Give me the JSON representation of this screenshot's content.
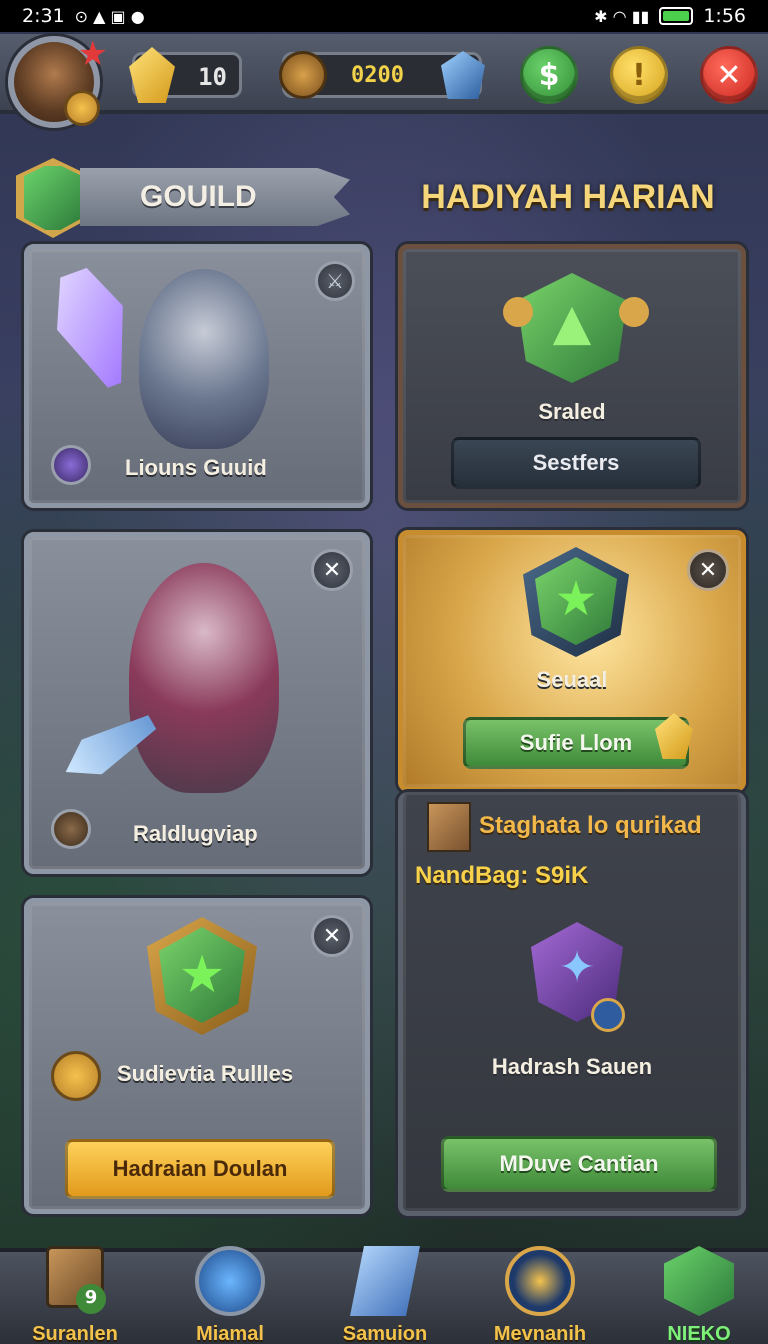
{
  "status_bar": {
    "time_left": "2:31",
    "time_right": "1:56"
  },
  "hud": {
    "gems": "10",
    "gold": "0200"
  },
  "guild": {
    "title": "GOUILD"
  },
  "daily": {
    "title": "HADIYAH HARIAN"
  },
  "cards_left": [
    {
      "name": "Liouns Guuid"
    },
    {
      "name": "Raldlugviap"
    },
    {
      "name": "Sudievtia Rullles",
      "button": "Hadraian Doulan"
    }
  ],
  "cards_right": {
    "scaled": {
      "name": "Sraled",
      "button": "Sestfers"
    },
    "sequal": {
      "name": "Seuaal",
      "button": "Sufie Llom"
    },
    "info": {
      "line1": "Staghata lo qurikad",
      "line2": "NandBag: S9iK"
    },
    "bottom": {
      "name": "Hadrash Sauen",
      "button": "MDuve Cantian"
    }
  },
  "bottom_nav": [
    {
      "label": "Suranlen",
      "badge": "9"
    },
    {
      "label": "Miamal"
    },
    {
      "label": "Samuion"
    },
    {
      "label": "Mevnanih"
    },
    {
      "label": "NIEKO"
    }
  ],
  "colors": {
    "gold_text": "#f6d67a",
    "green": "#3f8a39",
    "red": "#c9241e"
  }
}
